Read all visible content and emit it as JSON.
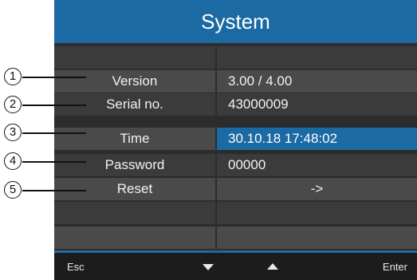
{
  "title": "System",
  "rows": [
    {
      "label": "Version",
      "value": "3.00 / 4.00",
      "callout": "1"
    },
    {
      "label": "Serial no.",
      "value": "43000009",
      "callout": "2"
    },
    {
      "label": "Time",
      "value": "30.10.18  17:48:02",
      "callout": "3",
      "selected": true
    },
    {
      "label": "Password",
      "value": "00000",
      "callout": "4"
    },
    {
      "label": "Reset",
      "value": "->",
      "callout": "5"
    }
  ],
  "footer": {
    "esc_label": "Esc",
    "down_icon": "down-triangle-icon",
    "up_icon": "up-triangle-icon",
    "enter_label": "Enter"
  },
  "colors": {
    "accent": "#1b6aa4",
    "background": "#2c2c2c",
    "row_dark": "#3b3b3b",
    "row_light": "#4a4a4a"
  }
}
